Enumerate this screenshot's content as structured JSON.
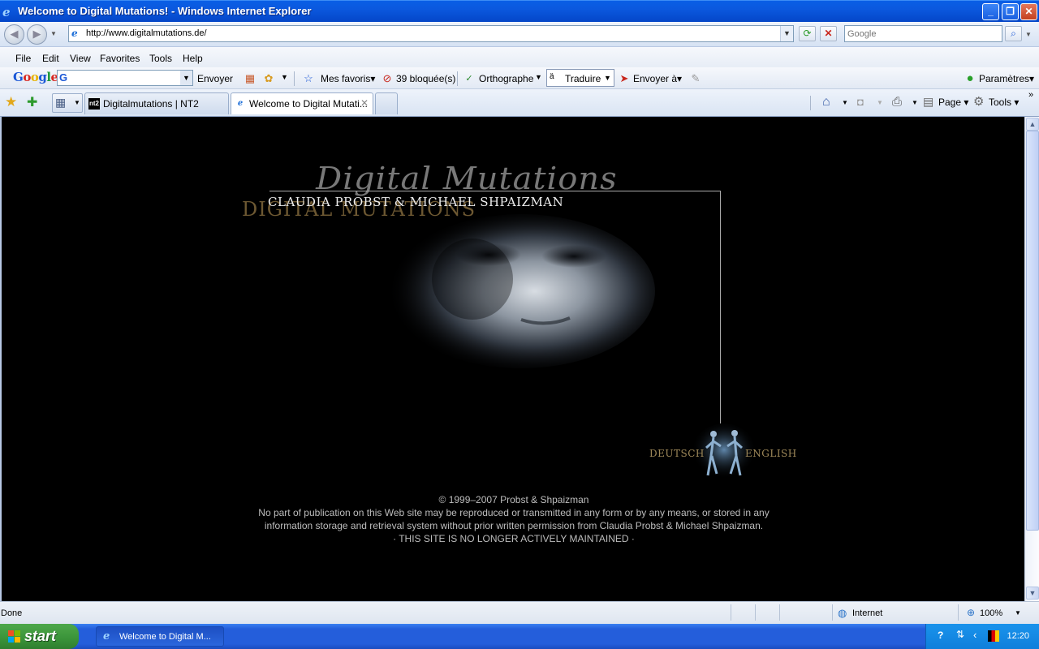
{
  "window": {
    "title": "Welcome to Digital Mutations! - Windows Internet Explorer",
    "minimize": "_",
    "maximize": "❐",
    "close": "✕"
  },
  "address_bar": {
    "url": "http://www.digitalmutations.de/",
    "search_placeholder": "Google"
  },
  "menu": [
    "File",
    "Edit",
    "View",
    "Favorites",
    "Tools",
    "Help"
  ],
  "google_toolbar": {
    "send": "Envoyer",
    "favorites": "Mes favoris",
    "blocked": "39 bloquée(s)",
    "spelling": "Orthographe",
    "translate": "Traduire",
    "send_to": "Envoyer à",
    "settings": "Paramètres"
  },
  "tabs": [
    {
      "label": "Digitalmutations | NT2",
      "icon": "nt2"
    },
    {
      "label": "Welcome to Digital Mutati...",
      "icon": "e"
    }
  ],
  "command_bar": {
    "page": "Page",
    "tools": "Tools"
  },
  "page": {
    "script_title": "Digital Mutations",
    "gold_title": "DIGITAL MUTATIONS",
    "authors": "CLAUDIA PROBST & MICHAEL SHPAIZMAN",
    "lang_deutsch": "DEUTSCH",
    "lang_english": "ENGLISH",
    "copyright": "© 1999–2007 Probst & Shpaizman",
    "notice_1": "No part of publication on this Web site may be reproduced or transmitted in any form or by any means, or stored in any",
    "notice_2": "information storage and retrieval system without prior written permission from Claudia Probst & Michael Shpaizman.",
    "maintenance": "· THIS SITE IS NO LONGER ACTIVELY MAINTAINED ·"
  },
  "status_bar": {
    "status": "Done",
    "zone": "Internet",
    "zoom": "100%"
  },
  "taskbar": {
    "start": "start",
    "task": "Welcome to Digital M...",
    "clock": "12:20"
  }
}
